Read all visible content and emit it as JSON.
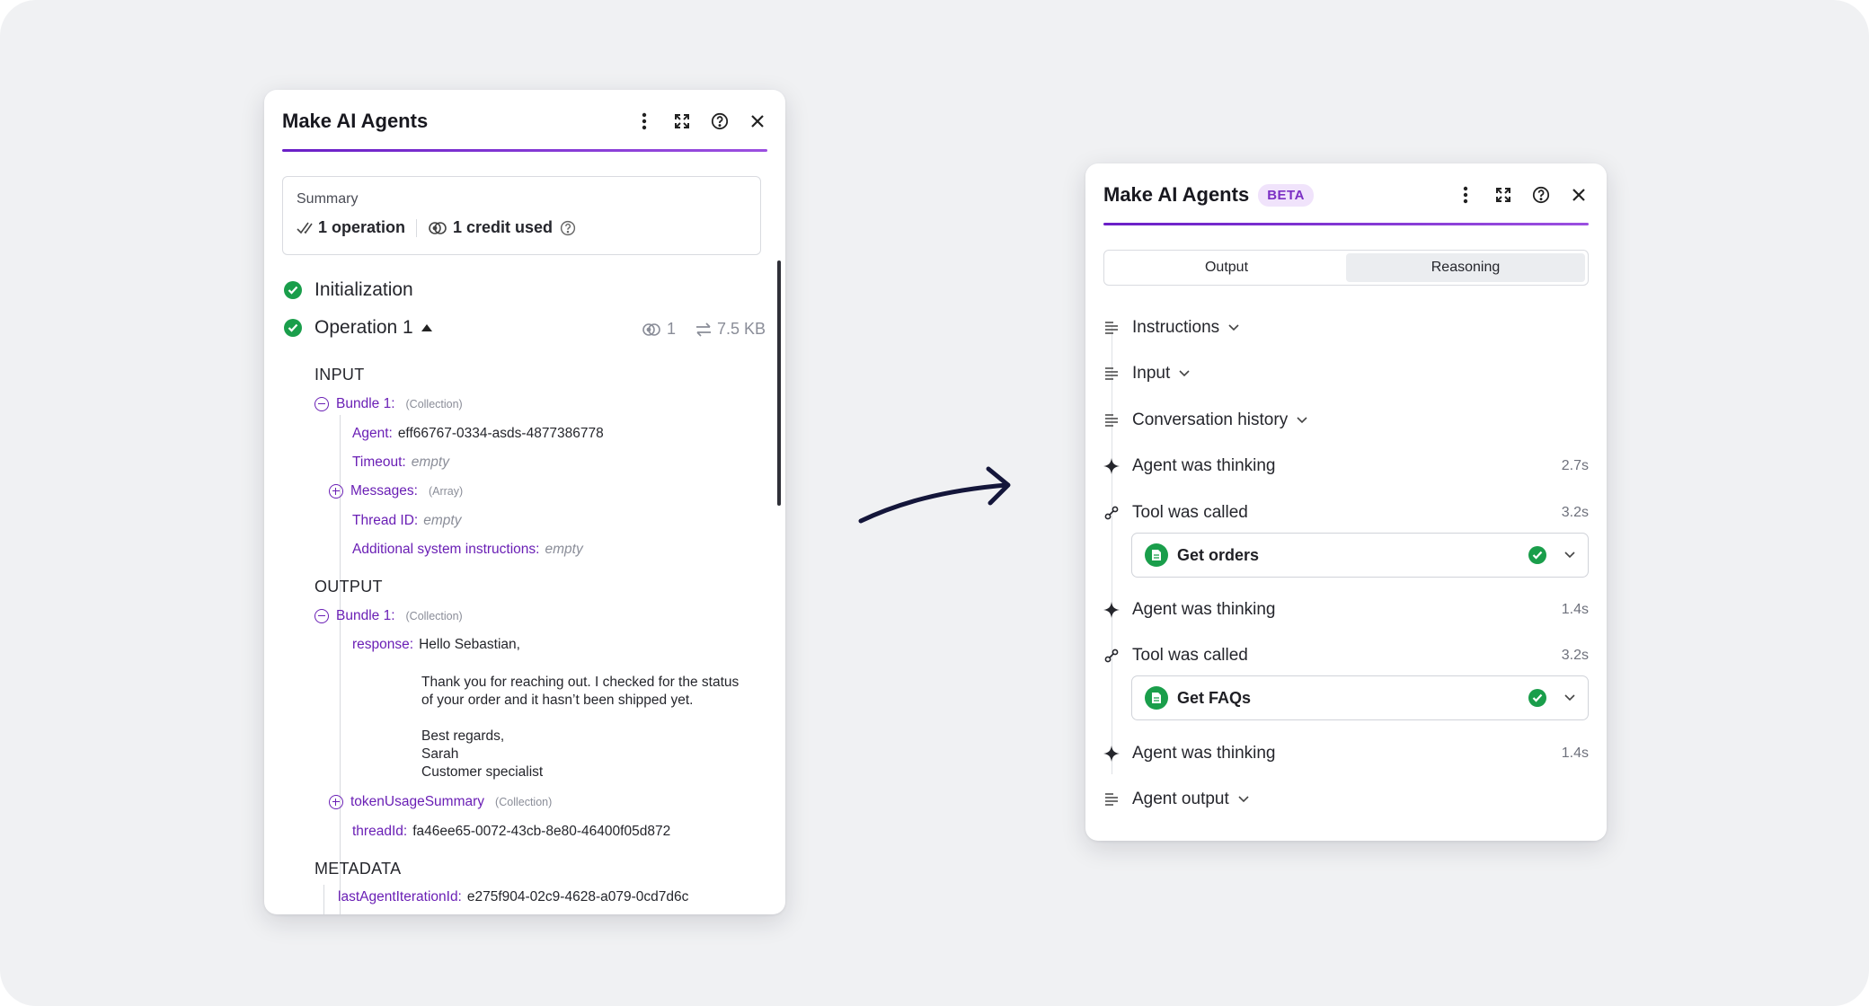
{
  "left_panel": {
    "title": "Make AI Agents",
    "summary": {
      "title": "Summary",
      "operations": "1 operation",
      "credits": "1 credit used"
    },
    "steps": {
      "initialization": "Initialization",
      "operation": "Operation 1",
      "op_credits": "1",
      "op_size": "7.5 KB"
    },
    "input": {
      "title": "INPUT",
      "bundle_label": "Bundle 1:",
      "bundle_type": "(Collection)",
      "agent_key": "Agent:",
      "agent_value": "eff66767-0334-asds-4877386778",
      "timeout_key": "Timeout:",
      "timeout_value": "empty",
      "messages_key": "Messages:",
      "messages_type": "(Array)",
      "thread_key": "Thread ID:",
      "thread_value": "empty",
      "additional_key": "Additional system instructions:",
      "additional_value": "empty"
    },
    "output": {
      "title": "OUTPUT",
      "bundle_label": "Bundle 1:",
      "bundle_type": "(Collection)",
      "response_key": "response:",
      "response_line1": "Hello Sebastian,",
      "response_line2": "Thank you for reaching out. I checked for the status",
      "response_line3": "of your order and it hasn’t been shipped yet.",
      "response_line4": "Best regards,",
      "response_line5": "Sarah",
      "response_line6": "Customer specialist",
      "token_key": "tokenUsageSummary",
      "token_type": "(Collection)",
      "thread_key": "threadId:",
      "thread_value": "fa46ee65-0072-43cb-8e80-46400f05d872"
    },
    "metadata": {
      "title": "METADATA",
      "iteration_key": "lastAgentIterationId:",
      "iteration_value": "e275f904-02c9-4628-a079-0cd7d6c"
    }
  },
  "right_panel": {
    "title": "Make AI Agents",
    "badge": "BETA",
    "tabs": [
      "Output",
      "Reasoning"
    ],
    "active_tab": "Reasoning",
    "rows": {
      "instructions": "Instructions",
      "input": "Input",
      "history": "Conversation history",
      "thinking1": "Agent was thinking",
      "thinking1_time": "2.7s",
      "tool1": "Tool was called",
      "tool1_time": "3.2s",
      "tool1_name": "Get orders",
      "thinking2": "Agent was thinking",
      "thinking2_time": "1.4s",
      "tool2": "Tool was called",
      "tool2_time": "3.2s",
      "tool2_name": "Get FAQs",
      "thinking3": "Agent was thinking",
      "thinking3_time": "1.4s",
      "output": "Agent output"
    }
  },
  "colors": {
    "accent": "#6a1fc7",
    "success": "#1a9e4b",
    "key_text": "#6a1fb5",
    "arrow": "#14163a"
  },
  "icons": [
    "more-vertical-icon",
    "expand-icon",
    "help-icon",
    "close-icon",
    "check-double-icon",
    "credit-icon",
    "success-icon",
    "caret-up-icon",
    "transfer-icon",
    "collapse-circle-icon",
    "expand-circle-icon",
    "text-lines-icon",
    "chevron-down-icon",
    "sparkle-icon",
    "tool-nodes-icon",
    "document-icon",
    "arrow-right-icon"
  ]
}
